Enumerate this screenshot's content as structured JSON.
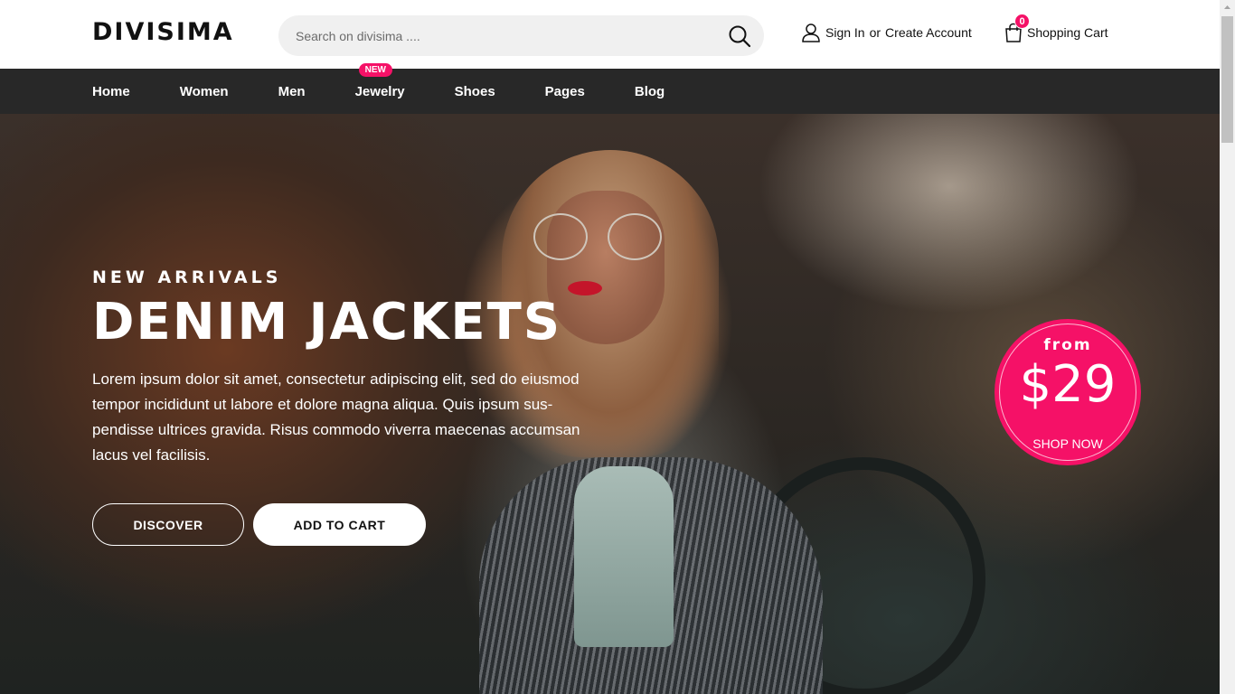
{
  "header": {
    "logo": "DIVISIMA",
    "search_placeholder": "Search on divisima ....",
    "sign_in": "Sign In",
    "or": "or",
    "create_account": "Create Account",
    "cart_label": "Shopping Cart",
    "cart_count": "0"
  },
  "nav": {
    "items": [
      {
        "label": "Home"
      },
      {
        "label": "Women"
      },
      {
        "label": "Men"
      },
      {
        "label": "Jewelry",
        "badge": "NEW"
      },
      {
        "label": "Shoes"
      },
      {
        "label": "Pages"
      },
      {
        "label": "Blog"
      }
    ]
  },
  "hero": {
    "subtitle": "NEW ARRIVALS",
    "title": "DENIM JACKETS",
    "description": "Lorem ipsum dolor sit amet, consectetur adipiscing elit, sed do eiusmod tempor incididunt ut labore et dolore magna aliqua. Quis ipsum sus-pendisse ultrices gravida. Risus commodo viverra maecenas accumsan lacus vel facilisis.",
    "discover_label": "DISCOVER",
    "add_to_cart_label": "ADD TO CART"
  },
  "offer": {
    "from": "from",
    "price": "$29",
    "cta": "SHOP NOW"
  },
  "colors": {
    "accent": "#f51167",
    "nav_bg": "#282828"
  }
}
